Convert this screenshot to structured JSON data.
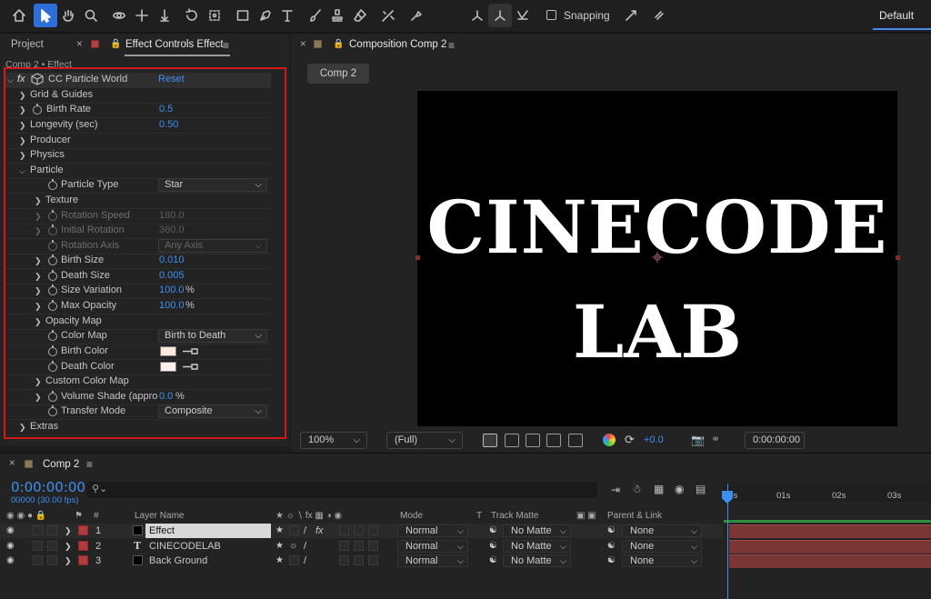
{
  "toolbar": {
    "snapping_label": "Snapping",
    "workspace_label": "Default",
    "tools": [
      "home-icon",
      "selection-icon",
      "hand-icon",
      "zoom-icon",
      "orbit-icon",
      "pan-icon",
      "dolly-icon",
      "rotate-icon",
      "pan-behind-icon",
      "rectangle-icon",
      "pen-icon",
      "type-icon",
      "brush-icon",
      "clone-stamp-icon",
      "eraser-icon",
      "roto-brush-icon",
      "puppet-icon"
    ]
  },
  "left_panel": {
    "tabs": [
      "Project",
      "Effect Controls Effect"
    ],
    "close_glyph": "×",
    "breadcrumb": "Comp 2 • Effect",
    "effect": {
      "fx_label": "fx",
      "name": "CC Particle World",
      "reset": "Reset"
    },
    "rows": [
      {
        "label": "Grid & Guides"
      },
      {
        "label": "Birth Rate",
        "value": "0.5"
      },
      {
        "label": "Longevity (sec)",
        "value": "0.50"
      },
      {
        "label": "Producer"
      },
      {
        "label": "Physics"
      },
      {
        "label": "Particle"
      },
      {
        "label": "Particle Type",
        "value": "Star"
      },
      {
        "label": "Texture"
      },
      {
        "label": "Rotation Speed",
        "value": "180.0"
      },
      {
        "label": "Initial Rotation",
        "value": "360.0"
      },
      {
        "label": "Rotation Axis",
        "value": "Any Axis"
      },
      {
        "label": "Birth Size",
        "value": "0.010"
      },
      {
        "label": "Death Size",
        "value": "0.005"
      },
      {
        "label": "Size Variation",
        "value": "100.0",
        "unit": "%"
      },
      {
        "label": "Max Opacity",
        "value": "100.0",
        "unit": "%"
      },
      {
        "label": "Opacity Map"
      },
      {
        "label": "Color Map",
        "value": "Birth to Death"
      },
      {
        "label": "Birth Color",
        "color": "#fde9dc"
      },
      {
        "label": "Death Color",
        "color": "#fff0f0"
      },
      {
        "label": "Custom Color Map"
      },
      {
        "label": "Volume Shade (appro",
        "value": "0.0",
        "unit": "%"
      },
      {
        "label": "Transfer Mode",
        "value": "Composite"
      },
      {
        "label": "Extras"
      }
    ]
  },
  "comp_panel": {
    "tab_title": "Composition Comp 2",
    "comp_button": "Comp 2",
    "canvas_line1": "CINECODE",
    "canvas_line2": "LAB",
    "zoom": "100%",
    "resolution": "(Full)",
    "exposure": "+0.0",
    "timecode": "0:00:00:00"
  },
  "timeline": {
    "title": "Comp 2",
    "timecode": "0:00:00:00",
    "frame_info": "00000 (30.00 fps)",
    "search_placeholder": "",
    "columns": {
      "hash": "#",
      "layer_name": "Layer Name",
      "mode": "Mode",
      "t": "T",
      "track_matte": "Track Matte",
      "parent": "Parent & Link"
    },
    "ruler_ticks": [
      "00s",
      "01s",
      "02s",
      "03s"
    ],
    "layers": [
      {
        "num": "1",
        "name": "Effect",
        "mode": "Normal",
        "matte": "No Matte",
        "parent": "None",
        "label_color": "#b13b3b",
        "type": "solid"
      },
      {
        "num": "2",
        "name": "CINECODELAB",
        "mode": "Normal",
        "matte": "No Matte",
        "parent": "None",
        "label_color": "#b13b3b",
        "type": "text"
      },
      {
        "num": "3",
        "name": "Back Ground",
        "mode": "Normal",
        "matte": "No Matte",
        "parent": "None",
        "label_color": "#b13b3b",
        "type": "solid"
      }
    ]
  }
}
